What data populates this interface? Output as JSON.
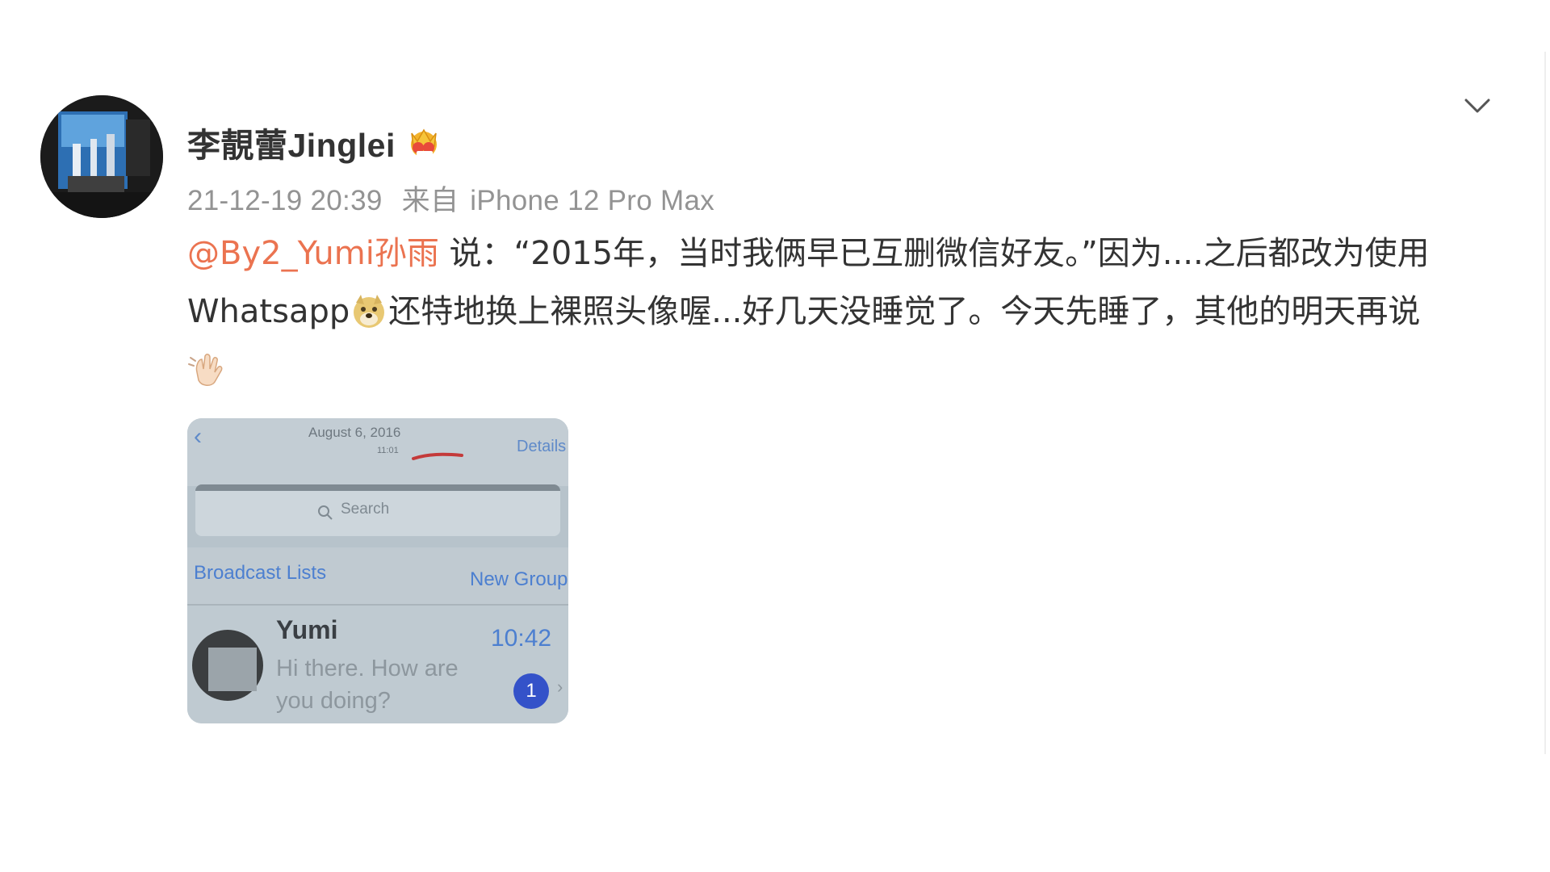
{
  "post": {
    "author": "李靚蕾Jinglei",
    "author_badge_icon": "crown-badge-icon",
    "timestamp": "21-12-19 20:39",
    "source_prefix": "来自",
    "source_device": "iPhone 12 Pro Max",
    "menu_icon": "chevron-down-icon",
    "mention": "@By2_Yumi孙雨",
    "text_part1": " 说：“2015年，当时我俩早已互删微信好友。”因为....之后都改为使用Whatsapp",
    "emoji1": "doge-emoji",
    "text_part2": "还特地换上裸照头像喔...好几天没睡觉了。今天先睡了，其他的明天再说",
    "emoji2": "waving-hand-emoji"
  },
  "image": {
    "header_date": "August 6, 2016",
    "header_time": "11:01",
    "details_label": "Details",
    "search_placeholder": "Search",
    "broadcast_label": "Broadcast Lists",
    "new_group_label": "New Group",
    "chat_name": "Yumi",
    "chat_time": "10:42",
    "chat_message": "Hi there. How are you doing?",
    "unread_count": "1"
  },
  "colors": {
    "mention": "#eb7350",
    "meta": "#939393",
    "text": "#333333"
  }
}
